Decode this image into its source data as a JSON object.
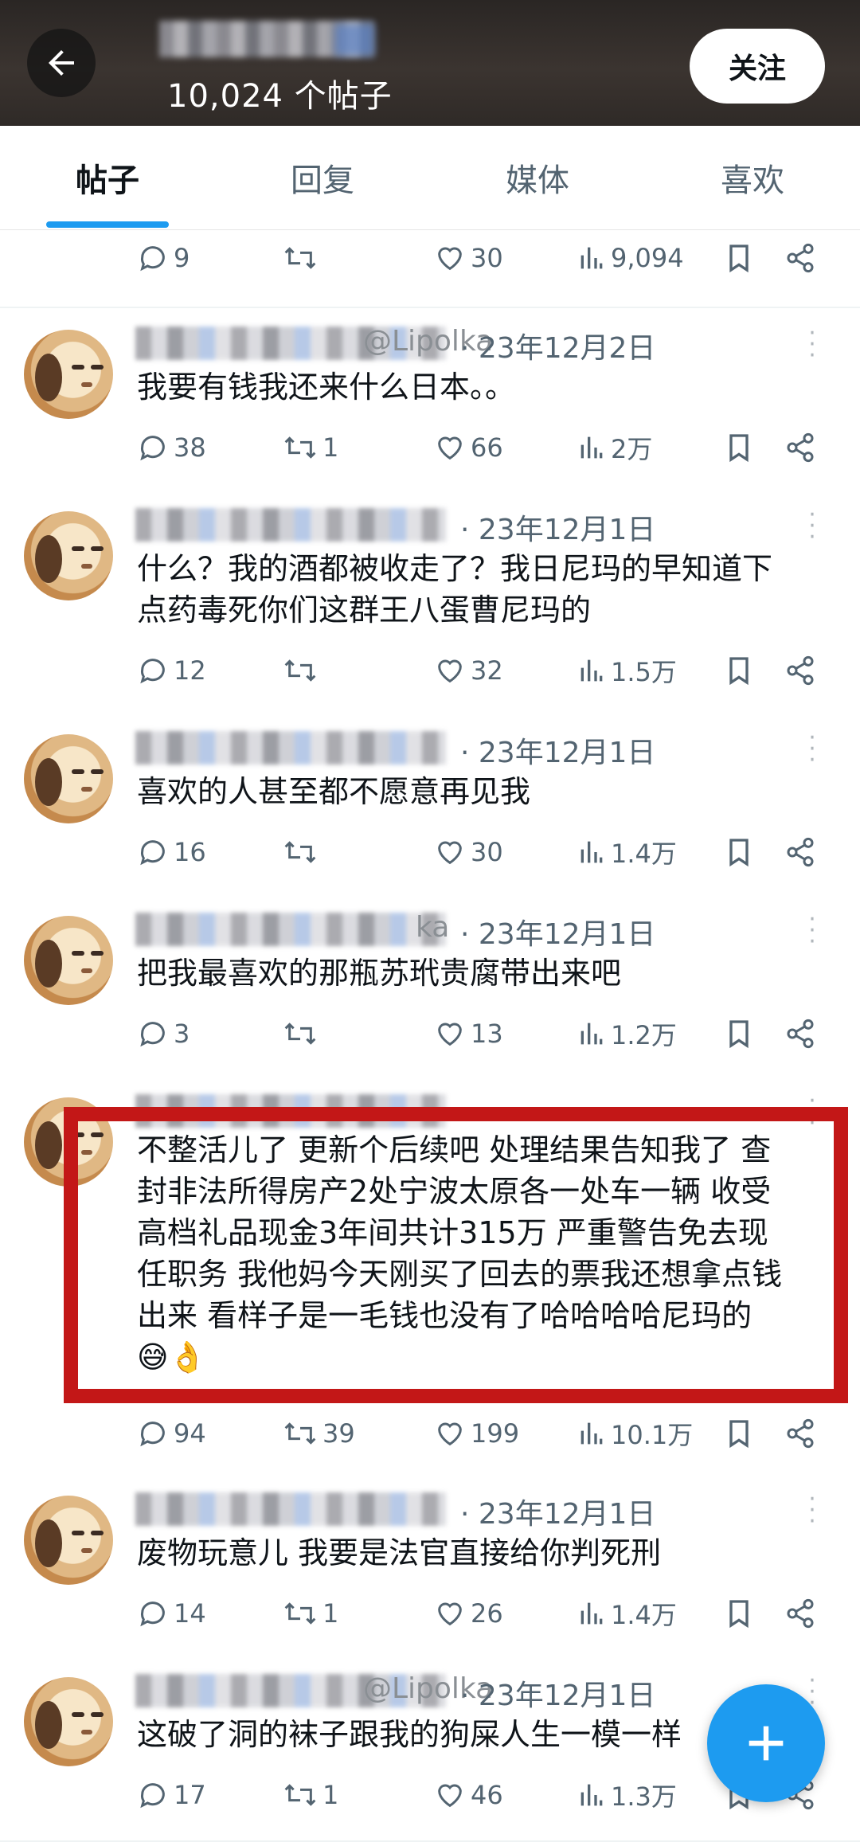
{
  "header": {
    "post_count": "10,024 个帖子",
    "follow_label": "关注"
  },
  "tabs": [
    {
      "label": "帖子",
      "active": true
    },
    {
      "label": "回复",
      "active": false
    },
    {
      "label": "媒体",
      "active": false
    },
    {
      "label": "喜欢",
      "active": false
    }
  ],
  "top_partial": {
    "replies": "9",
    "retweets": "",
    "likes": "30",
    "views": "9,094"
  },
  "posts": [
    {
      "handle_tail": "@Lipolka",
      "date": "· 23年12月2日",
      "text": "我要有钱我还来什么日本。。",
      "replies": "38",
      "retweets": "1",
      "likes": "66",
      "views": "2万"
    },
    {
      "handle_tail": "",
      "date": "· 23年12月1日",
      "text": "什么？我的酒都被收走了？我日尼玛的早知道下\n点药毒死你们这群王八蛋曹尼玛的",
      "replies": "12",
      "retweets": "",
      "likes": "32",
      "views": "1.5万"
    },
    {
      "handle_tail": "",
      "date": "· 23年12月1日",
      "text": "喜欢的人甚至都不愿意再见我",
      "replies": "16",
      "retweets": "",
      "likes": "30",
      "views": "1.4万"
    },
    {
      "handle_tail": "ka",
      "date": "· 23年12月1日",
      "text": "把我最喜欢的那瓶苏玳贵腐带出来吧",
      "replies": "3",
      "retweets": "",
      "likes": "13",
      "views": "1.2万"
    },
    {
      "handle_tail": "",
      "date": "",
      "text": "不整活儿了 更新个后续吧 处理结果告知我了 查\n封非法所得房产2处宁波太原各一处车一辆 收受\n高档礼品现金3年间共计315万 严重警告免去现\n任职务 我他妈今天刚买了回去的票我还想拿点钱\n出来 看样子是一毛钱也没有了哈哈哈哈尼玛的\n😅👌",
      "replies": "94",
      "retweets": "39",
      "likes": "199",
      "views": "10.1万"
    },
    {
      "handle_tail": "",
      "date": "· 23年12月1日",
      "text": "废物玩意儿 我要是法官直接给你判死刑",
      "replies": "14",
      "retweets": "1",
      "likes": "26",
      "views": "1.4万"
    },
    {
      "handle_tail": "@Lipolka",
      "date": "· 23年12月1日",
      "text": "这破了洞的袜子跟我的狗屎人生一模一样",
      "replies": "17",
      "retweets": "1",
      "likes": "46",
      "views": "1.3万"
    }
  ],
  "colors": {
    "accent": "#1d9bf0",
    "highlight_box": "#c31717",
    "icon_gray": "#536471"
  },
  "icons": {
    "back": "arrow-left-icon",
    "reply": "speech-bubble-icon",
    "retweet": "retweet-icon",
    "like": "heart-icon",
    "views": "bar-chart-icon",
    "bookmark": "bookmark-icon",
    "share": "share-icon",
    "more": "vertical-dots-icon",
    "compose": "plus-icon"
  }
}
